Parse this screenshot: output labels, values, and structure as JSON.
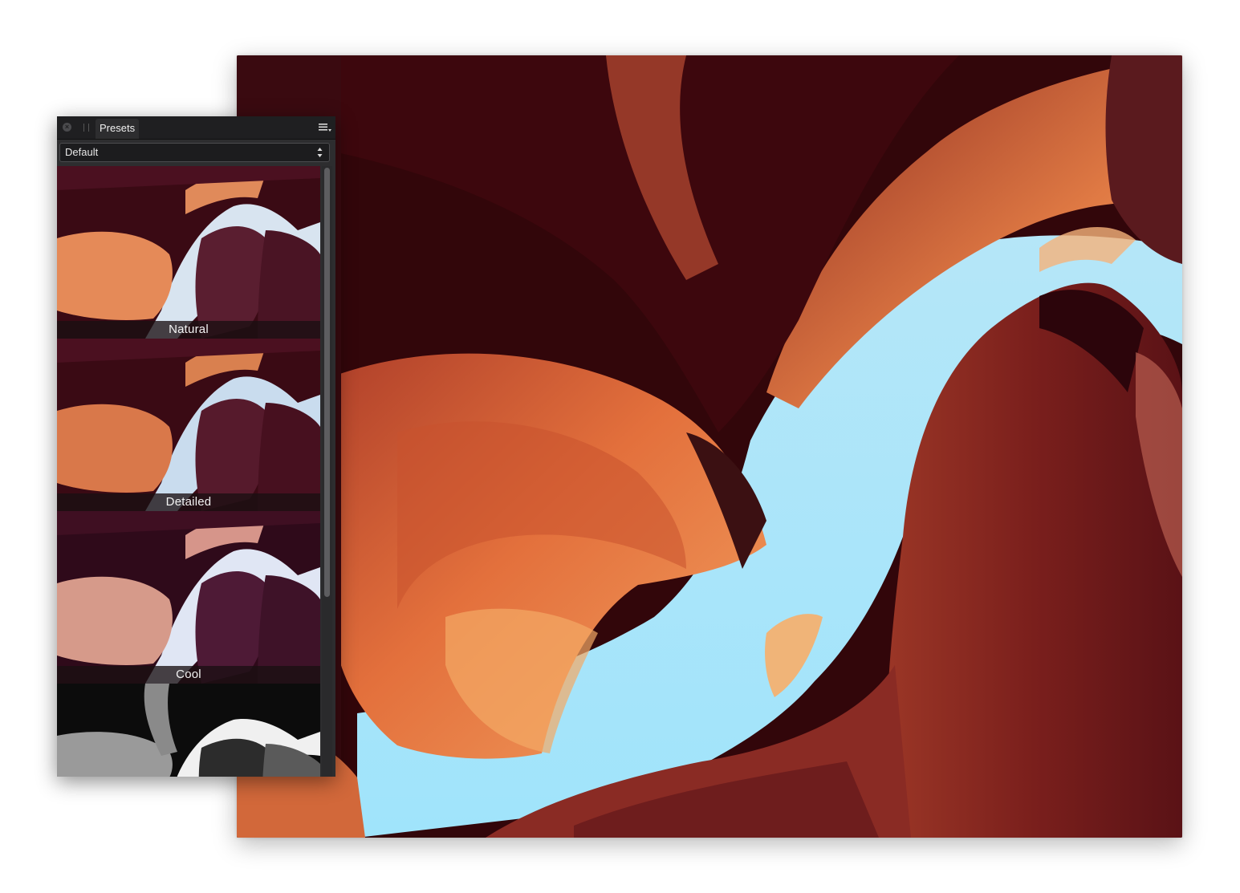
{
  "panel": {
    "tab_label": "Presets",
    "preset_group": "Default",
    "icons": {
      "close": "close-icon",
      "grip": "grip-icon",
      "menu": "panel-menu-icon",
      "select_arrows": "updown-arrows-icon"
    },
    "presets": [
      {
        "label": "Natural",
        "tint": "natural"
      },
      {
        "label": "Detailed",
        "tint": "detailed"
      },
      {
        "label": "Cool",
        "tint": "cool"
      },
      {
        "label": "",
        "tint": "mono"
      }
    ]
  },
  "colors": {
    "panel_bg": "#2d2d2f",
    "tabbar_bg": "#1f1f21",
    "sky": "#a6e2fa",
    "rock_dark": "#3a060b",
    "rock_red": "#a8301f",
    "rock_orange": "#e2763e"
  }
}
